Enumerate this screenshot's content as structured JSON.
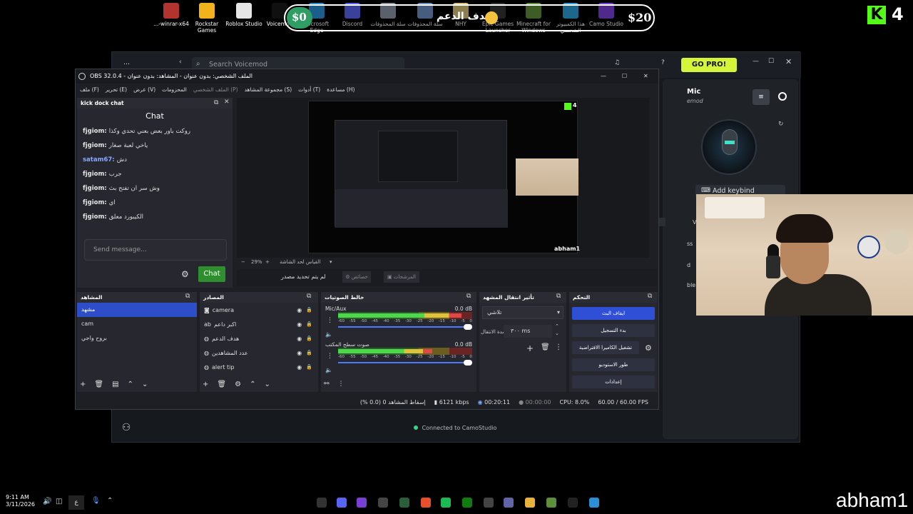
{
  "desktop_icons": [
    {
      "label": "...-winrar-x64",
      "color": "#b3342e",
      "icon": "winrar-icon"
    },
    {
      "label": "Rockstar Games",
      "color": "#f2b21c",
      "icon": "rockstar-icon"
    },
    {
      "label": "Roblox Studio",
      "color": "#e6e6e6",
      "icon": "roblox-icon"
    },
    {
      "label": "Voicemod",
      "color": "#101010",
      "icon": "voicemod-icon"
    },
    {
      "label": "Microsoft Edge",
      "color": "#2a8fd6",
      "icon": "edge-icon"
    },
    {
      "label": "Discord",
      "color": "#5865f2",
      "icon": "discord-icon"
    },
    {
      "label": "سلة المحذوفات",
      "color": "#8a96a8",
      "icon": "recycle-bin-icon"
    },
    {
      "label": "سلة المحذوفات",
      "color": "#6c90c4",
      "icon": "recycle-bin-full-icon"
    },
    {
      "label": "NHY",
      "color": "#d9c27a",
      "icon": "folder-icon"
    },
    {
      "label": "Epic Games Launcher",
      "color": "#333333",
      "icon": "epic-games-icon"
    },
    {
      "label": "Minecraft for Windows",
      "color": "#5e8f3a",
      "icon": "minecraft-icon"
    },
    {
      "label": "هذا الكمبيوتر الشخصي",
      "color": "#2f9fd8",
      "icon": "this-pc-icon"
    },
    {
      "label": "Camo Studio",
      "color": "#7a3fd6",
      "icon": "camo-icon"
    }
  ],
  "donation": {
    "current": "$0",
    "label": "هدف الدعم",
    "goal": "$20",
    "accent": "#2e9e64"
  },
  "kick_badge": {
    "count": "4",
    "color": "#53fc18"
  },
  "voicemod": {
    "search_placeholder": "Search Voicemod",
    "gopro_label": "GO PRO!",
    "mic_title": "Mic",
    "mic_sub": "emod",
    "keybind_label": "Add keybind",
    "connected": "Connected to CamoStudio",
    "side_labels": [
      "een",
      "V",
      "ss",
      "d",
      "ble"
    ]
  },
  "obs": {
    "title": "OBS 32.0.4 - الملف الشخصي: بدون عنوان - المشاهد: بدون عنوان",
    "menu": [
      "ملف (F)",
      "تحرير (E)",
      "عرض (V)",
      "المحزومات",
      "الملف الشخصي (P)",
      "مجموعة المشاهد (S)",
      "أدوات (T)",
      "مساعدة (H)"
    ],
    "chat_dock": {
      "title": "kick dock chat",
      "heading": "Chat",
      "messages": [
        {
          "user": "fjgiom:",
          "text": "روكت باور بعض بعني تحدي وكذا",
          "blue": false
        },
        {
          "user": "fjgiom:",
          "text": "ياخي لعبة صغار",
          "blue": false
        },
        {
          "user": "satam67:",
          "text": "دش",
          "blue": true
        },
        {
          "user": "fjgiom:",
          "text": "جرب",
          "blue": false
        },
        {
          "user": "fjgiom:",
          "text": "وش سر ان تفتح بث",
          "blue": false
        },
        {
          "user": "fjgiom:",
          "text": "اي",
          "blue": false
        },
        {
          "user": "fjgiom:",
          "text": "الكيبورد معلق",
          "blue": false
        }
      ],
      "input_placeholder": "Send message...",
      "send_label": "Chat"
    },
    "preview": {
      "zoom": "29%",
      "zoom_label": "القياس لحد الشاشة",
      "watermark": "abham1",
      "preview_kick": "4",
      "no_source": "لم يتم تحديد مصدر",
      "properties_label": "خصائص",
      "filters_label": "المرشحات"
    },
    "scenes": {
      "title": "المشاهد",
      "items": [
        {
          "label": "مشهد",
          "selected": true
        },
        {
          "label": "cam",
          "selected": false
        },
        {
          "label": "بروح واجي",
          "selected": false
        }
      ]
    },
    "sources": {
      "title": "المصادر",
      "items": [
        {
          "label": "camera",
          "icon": "camera-icon"
        },
        {
          "label": "اكبر داعم",
          "icon": "text-icon"
        },
        {
          "label": "هدف الدعم",
          "icon": "browser-icon"
        },
        {
          "label": "عدد المشاهدين",
          "icon": "browser-icon"
        },
        {
          "label": "alert tip",
          "icon": "browser-icon"
        }
      ]
    },
    "mixer": {
      "title": "خالط الصوتيات",
      "channels": [
        {
          "name": "Mic/Aux",
          "db": "0.0 dB",
          "level": 0.92
        },
        {
          "name": "صوت سطح المكتب",
          "db": "0.0 dB",
          "level": 0.7
        }
      ],
      "scale": [
        "-60",
        "-55",
        "-50",
        "-45",
        "-40",
        "-35",
        "-30",
        "-25",
        "-20",
        "-15",
        "-10",
        "-5",
        "0"
      ]
    },
    "transitions": {
      "title": "تأثير انتقال المشهد",
      "selected": "تلاشي",
      "duration_label": "مدة الانتقال",
      "duration_value": "٣٠٠ ms"
    },
    "controls": {
      "title": "التحكم",
      "buttons": [
        {
          "label": "ايقاف البث",
          "primary": true
        },
        {
          "label": "بدء التسجيل",
          "primary": false
        },
        {
          "label": "تشغيل الكاميرا الافتراضية",
          "primary": false
        },
        {
          "label": "طور الاستوديو",
          "primary": false
        },
        {
          "label": "إعدادات",
          "primary": false
        }
      ]
    },
    "status": {
      "dropped": "إسقاط المشاهد 0 (0.0 %)",
      "bitrate": "6121 kbps",
      "stream_time": "00:20:11",
      "rec_time": "00:00:00",
      "cpu": "CPU: 8.0%",
      "fps": "60.00 / 60.00 FPS"
    }
  },
  "clock": {
    "time": "9:11 AM",
    "date": "3/11/2026",
    "lang": "ع"
  },
  "watermark": "abham1"
}
